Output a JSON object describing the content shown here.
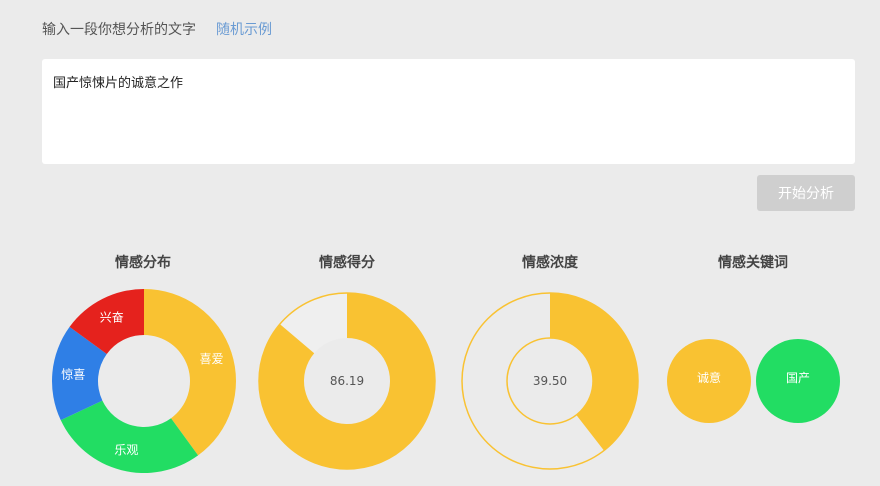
{
  "header": {
    "prompt": "输入一段你想分析的文字",
    "random_example": "随机示例"
  },
  "input": {
    "value": "国产惊悚片的诚意之作"
  },
  "actions": {
    "analyze_label": "开始分析"
  },
  "panels": {
    "distribution_title": "情感分布",
    "score_title": "情感得分",
    "intensity_title": "情感浓度",
    "keywords_title": "情感关键词"
  },
  "colors": {
    "yellow": "#f9c232",
    "green": "#22dd63",
    "blue": "#2f7fe6",
    "red": "#e5221d",
    "light": "#efefef"
  },
  "chart_data": [
    {
      "type": "pie",
      "title": "情感分布",
      "categories": [
        "喜爱",
        "乐观",
        "惊喜",
        "兴奋"
      ],
      "values": [
        40,
        28,
        17,
        15
      ]
    },
    {
      "type": "pie",
      "title": "情感得分",
      "value": 86.19,
      "max": 100,
      "label": "86.19"
    },
    {
      "type": "pie",
      "title": "情感浓度",
      "value": 39.5,
      "max": 100,
      "label": "39.50"
    },
    {
      "type": "table",
      "title": "情感关键词",
      "keywords": [
        "诚意",
        "国产"
      ]
    }
  ]
}
